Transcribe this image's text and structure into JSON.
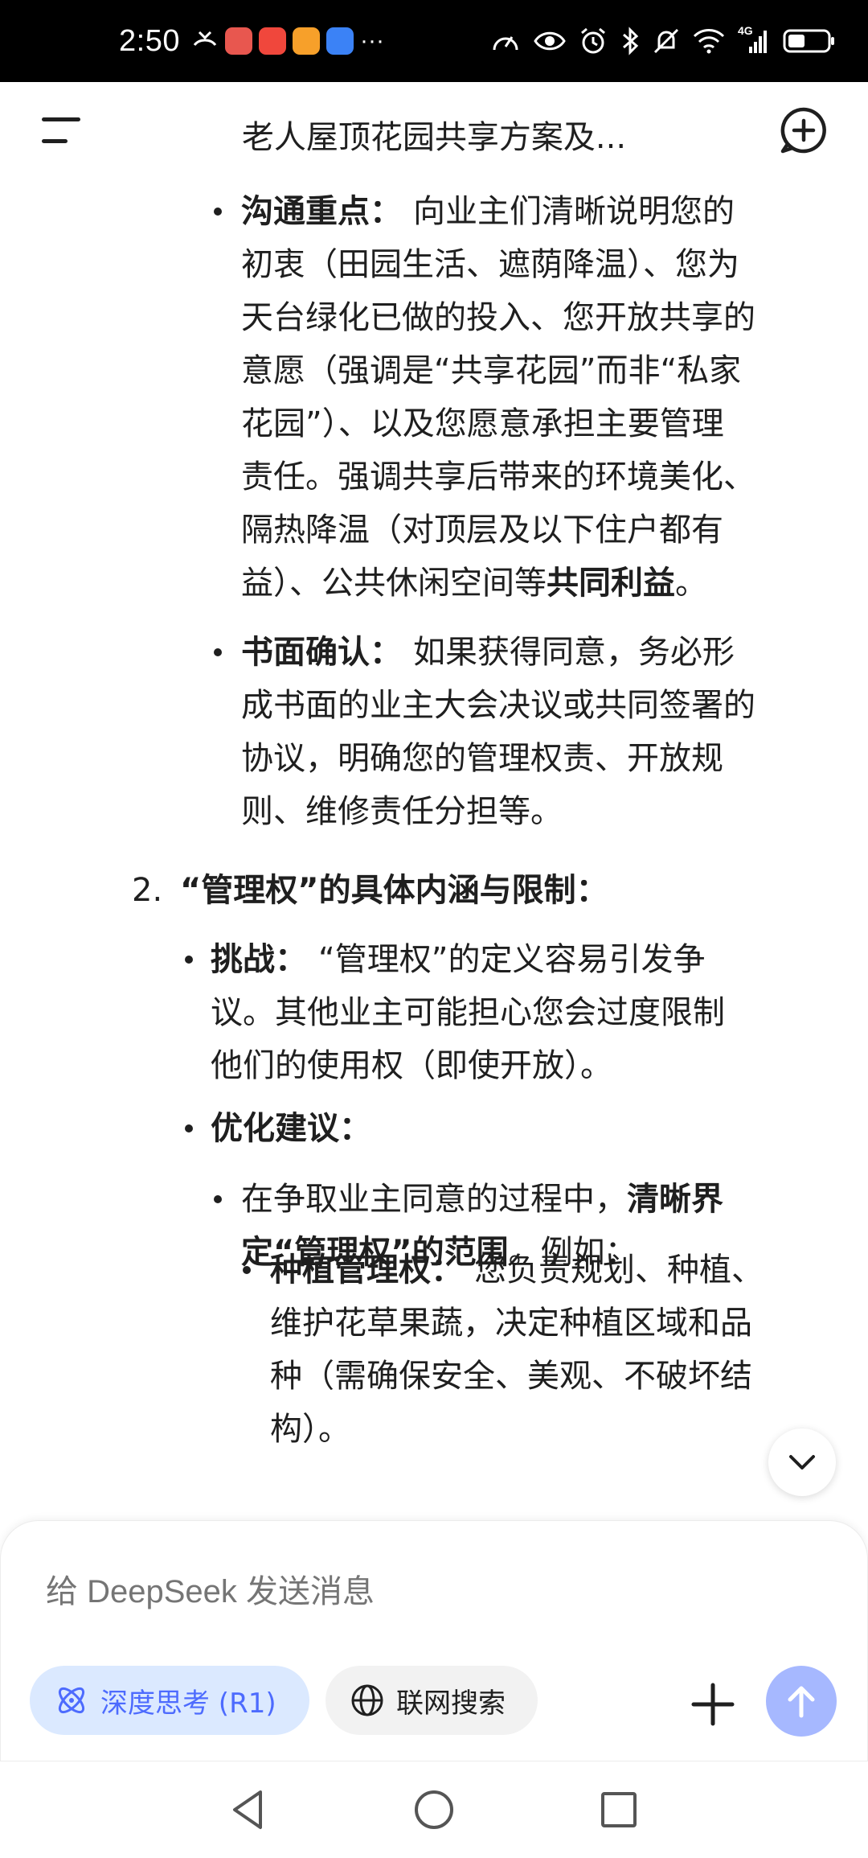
{
  "status_bar": {
    "time": "2:50",
    "ellipsis": "···",
    "network_label": "4G",
    "icons": [
      "missed-call-icon",
      "app-red-icon",
      "app-red-icon",
      "app-orange-icon",
      "app-blue-icon",
      "speed-icon",
      "eye-icon",
      "alarm-icon",
      "bluetooth-icon",
      "mute-icon",
      "wifi-icon",
      "signal-icon",
      "battery-icon"
    ]
  },
  "header": {
    "title": "老人屋顶花园共享方案及..."
  },
  "content": {
    "bullet1": {
      "label": "沟通重点：",
      "lines": [
        "向业主们清晰说明您的",
        "初衷（田园生活、遮荫降温）、您为",
        "天台绿化已做的投入、您开放共享的",
        "意愿（强调是“共享花园”而非“私家",
        "花园”）、以及您愿意承担主要管理",
        "责任。强调共享后带来的环境美化、",
        "隔热降温（对顶层及以下住户都有",
        "益）、公共休闲空间等"
      ],
      "bold_end": "共同利益",
      "end": "。"
    },
    "bullet2": {
      "label": "书面确认：",
      "lines": [
        "如果获得同意，务必形",
        "成书面的业主大会决议或共同签署的",
        "协议，明确您的管理权责、开放规",
        "则、维修责任分担等。"
      ]
    },
    "section2": {
      "number": "2.",
      "title": "“管理权”的具体内涵与限制："
    },
    "challenge": {
      "label": "挑战：",
      "lines": [
        "“管理权”的定义容易引发争",
        "议。其他业主可能担心您会过度限制",
        "他们的使用权（即使开放）。"
      ]
    },
    "suggestion": {
      "label": "优化建议："
    },
    "sub1": {
      "line1_normal": "在争取业主同意的过程中，",
      "line1_bold": "清晰界",
      "line2_bold": "定“管理权”的范围",
      "line2_normal": "。例如："
    },
    "sub2": {
      "label": "种植管理权：",
      "lines": [
        "您负责规划、种植、",
        "维护花草果蔬，决定种植区域和品",
        "种（需确保安全、美观、不破坏结",
        "构）。"
      ]
    }
  },
  "composer": {
    "placeholder": "给 DeepSeek 发送消息",
    "deep_think_label": "深度思考 (R1)",
    "web_search_label": "联网搜索"
  },
  "colors": {
    "accent": "#4d6bfe",
    "chip_active_bg": "#dbe9ff",
    "send_disabled": "#a6b8ff"
  }
}
